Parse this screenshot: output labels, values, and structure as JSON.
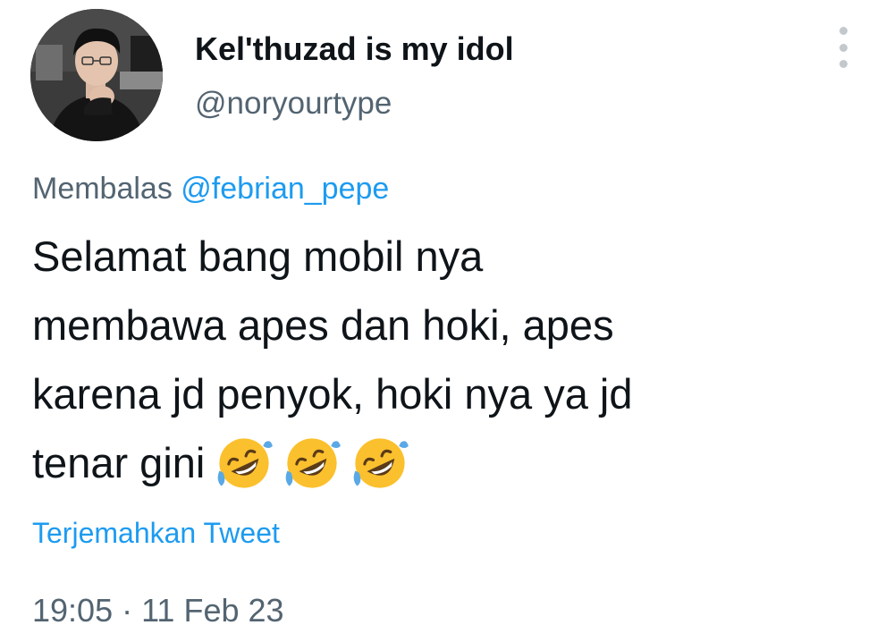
{
  "author": {
    "display_name": "Kel'thuzad is my idol",
    "handle": "@noryourtype",
    "avatar_icon": "profile-photo"
  },
  "reply": {
    "prefix": "Membalas",
    "mention": "@febrian_pepe"
  },
  "tweet": {
    "lines": [
      "Selamat bang mobil nya",
      "membawa apes dan hoki, apes",
      "karena jd penyok, hoki nya ya jd",
      "tenar gini"
    ],
    "emojis": [
      "rolling-on-floor-laughing-icon",
      "rolling-on-floor-laughing-icon",
      "rolling-on-floor-laughing-icon"
    ]
  },
  "translate_label": "Terjemahkan Tweet",
  "timestamp": "19:05 · 11 Feb 23",
  "colors": {
    "text_primary": "#0f1419",
    "text_secondary": "#536471",
    "link": "#1d9bf0",
    "more_dots": "#c3c8cc"
  },
  "more_icon": "more-vertical-icon"
}
